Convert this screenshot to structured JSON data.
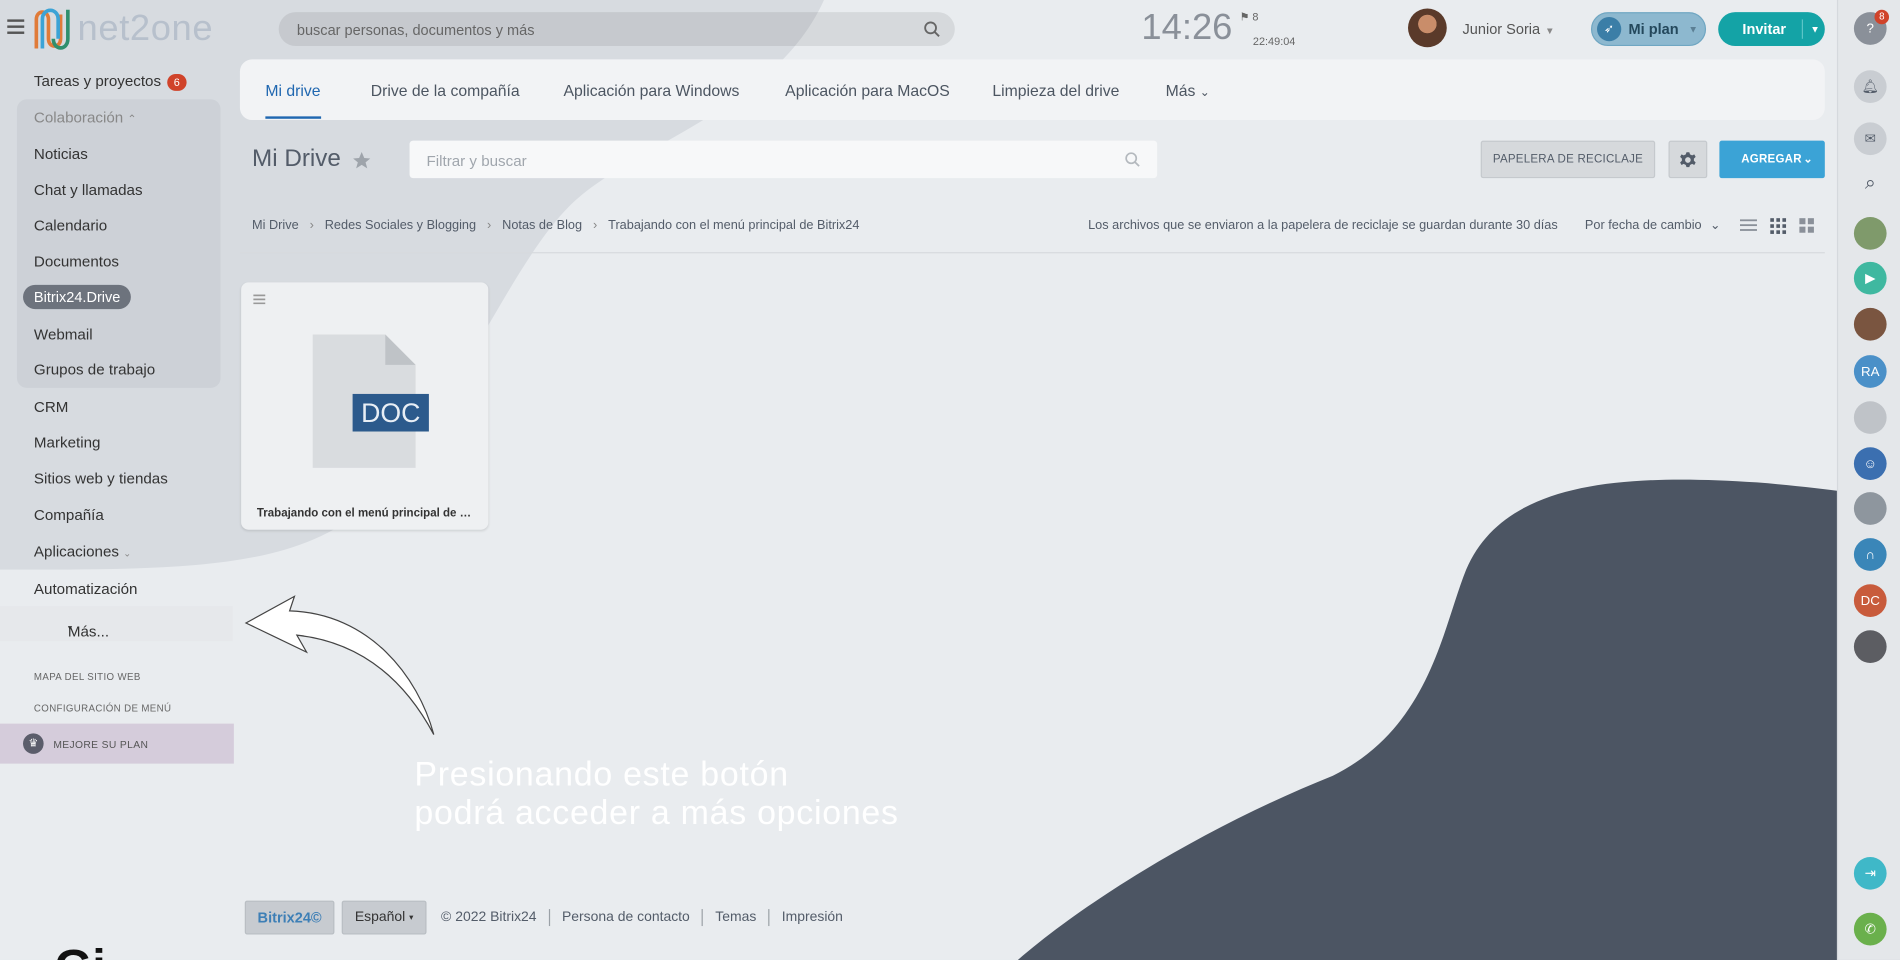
{
  "brand": {
    "logo_text": "net2one"
  },
  "header": {
    "search_placeholder": "buscar personas, documentos y más",
    "clock": "14:26",
    "flag_count": "8",
    "clock_secondary": "22:49:04",
    "user_name": "Junior Soria",
    "plan_label": "Mi plan",
    "invite_label": "Invitar"
  },
  "sidebar": {
    "tasks": {
      "label": "Tareas y proyectos",
      "badge": "6"
    },
    "section_label": "Colaboración",
    "collab_items": [
      "Noticias",
      "Chat y llamadas",
      "Calendario",
      "Documentos",
      "Bitrix24.Drive",
      "Webmail",
      "Grupos de trabajo"
    ],
    "items": [
      "CRM",
      "Marketing",
      "Sitios web y tiendas",
      "Compañía",
      "Aplicaciones",
      "Automatización"
    ],
    "more_label": "Más...",
    "sitemap_label": "MAPA DEL SITIO WEB",
    "menu_config_label": "CONFIGURACIÓN DE MENÚ",
    "upgrade_label": "MEJORE SU PLAN"
  },
  "tabs": [
    "Mi drive",
    "Drive de la compañía",
    "Aplicación para Windows",
    "Aplicación para MacOS",
    "Limpieza del drive",
    "Más"
  ],
  "toolbar": {
    "title": "Mi Drive",
    "filter_placeholder": "Filtrar y buscar",
    "recycle_label": "PAPELERA DE RECICLAJE",
    "add_label": "AGREGAR"
  },
  "breadcrumb": [
    "Mi Drive",
    "Redes Sociales y Blogging",
    "Notas de Blog",
    "Trabajando con el menú principal de Bitrix24"
  ],
  "recycle_info": "Los archivos que se enviaron a la papelera de reciclaje se guardan durante 30 días",
  "sort_label": "Por fecha de cambio",
  "files": [
    {
      "type": "DOC",
      "name": "Trabajando con el menú principal de Bi..."
    }
  ],
  "annotation": {
    "line1": "Presionando este botón",
    "line2": "podrá acceder a más opciones"
  },
  "right_panel": {
    "badge_count": "8",
    "avatar_initials": [
      "RA",
      "DC"
    ]
  },
  "footer": {
    "logo": "Bitrix24©",
    "language": "Español",
    "copyright": "© 2022 Bitrix24",
    "links": [
      "Persona de contacto",
      "Temas",
      "Impresión"
    ]
  },
  "colors": {
    "accent": "#2067b0",
    "invite": "#14a3a6",
    "add_button": "#3ba3d6",
    "badge": "#d0432a",
    "overlay_shape": "#4c5563"
  }
}
